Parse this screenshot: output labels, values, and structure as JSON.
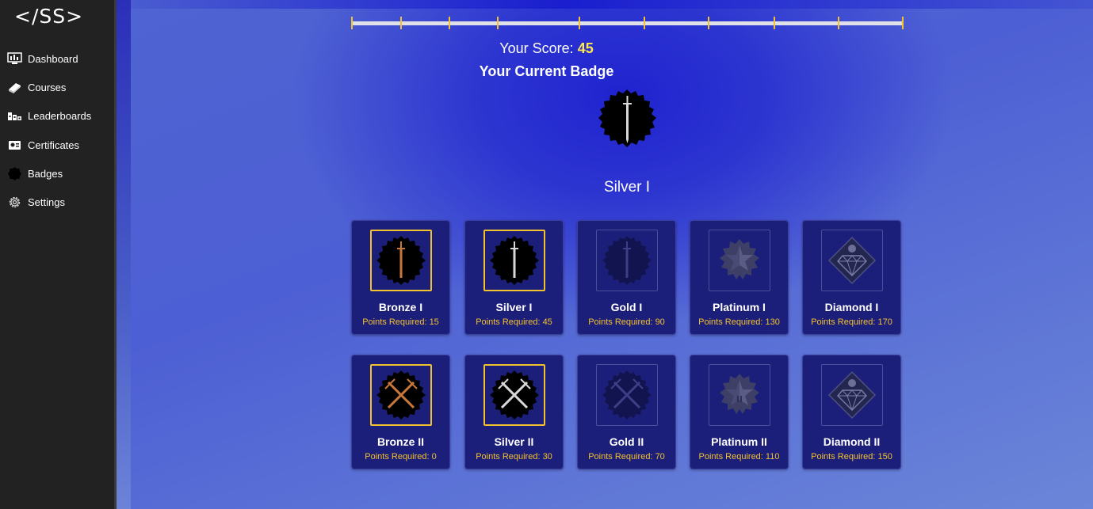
{
  "app": {
    "logo": "</SS>"
  },
  "sidebar": {
    "items": [
      {
        "label": "Dashboard",
        "icon": "dashboard-icon"
      },
      {
        "label": "Courses",
        "icon": "book-icon"
      },
      {
        "label": "Leaderboards",
        "icon": "leaderboard-icon"
      },
      {
        "label": "Certificates",
        "icon": "certificate-icon"
      },
      {
        "label": "Badges",
        "icon": "badge-icon"
      },
      {
        "label": "Settings",
        "icon": "gear-icon"
      }
    ]
  },
  "progress": {
    "ticks": 9
  },
  "score": {
    "label": "Your Score:",
    "value": "45"
  },
  "current_badge": {
    "title": "Your Current Badge",
    "name": "Silver I",
    "icon": "silver-sword-badge-icon"
  },
  "badges_row1": [
    {
      "name": "Bronze I",
      "points": "Points Required: 15",
      "unlocked": true
    },
    {
      "name": "Silver I",
      "points": "Points Required: 45",
      "unlocked": true
    },
    {
      "name": "Gold I",
      "points": "Points Required: 90",
      "unlocked": false
    },
    {
      "name": "Platinum I",
      "points": "Points Required: 130",
      "unlocked": false
    },
    {
      "name": "Diamond I",
      "points": "Points Required: 170",
      "unlocked": false
    }
  ],
  "badges_row2": [
    {
      "name": "Bronze II",
      "points": "Points Required: 0",
      "unlocked": true
    },
    {
      "name": "Silver II",
      "points": "Points Required: 30",
      "unlocked": true
    },
    {
      "name": "Gold II",
      "points": "Points Required: 70",
      "unlocked": false
    },
    {
      "name": "Platinum II",
      "points": "Points Required: 110",
      "unlocked": false
    },
    {
      "name": "Diamond II",
      "points": "Points Required: 150",
      "unlocked": false
    }
  ],
  "colors": {
    "accent": "#f2c12e",
    "score_value": "#ffe84a",
    "card_bg": "#1c1f7a",
    "bronze": "#c8783a",
    "silver": "#d8d8d8"
  }
}
